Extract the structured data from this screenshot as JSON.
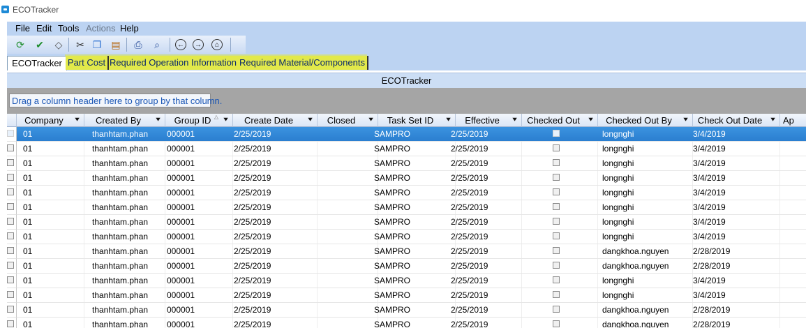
{
  "window": {
    "title": "ECOTracker"
  },
  "menu": [
    {
      "label": "File",
      "disabled": false
    },
    {
      "label": "Edit",
      "disabled": false
    },
    {
      "label": "Tools",
      "disabled": false
    },
    {
      "label": "Actions",
      "disabled": true
    },
    {
      "label": "Help",
      "disabled": false
    }
  ],
  "toolbar": [
    {
      "icon": "refresh-icon",
      "glyph": "⟳",
      "color": "#1c8c2a"
    },
    {
      "icon": "save-icon",
      "glyph": "✔",
      "color": "#1c8c2a"
    },
    {
      "icon": "eraser-icon",
      "glyph": "◇",
      "color": "#555555"
    },
    {
      "icon": "cut-icon",
      "glyph": "✂",
      "color": "#333333"
    },
    {
      "icon": "copy-icon",
      "glyph": "❐",
      "color": "#2a6fd1"
    },
    {
      "icon": "paste-icon",
      "glyph": "▤",
      "color": "#b76b17"
    },
    {
      "icon": "print-icon",
      "glyph": "⎙",
      "color": "#2a4f9a"
    },
    {
      "icon": "print-preview-icon",
      "glyph": "⌕",
      "color": "#2a4f9a"
    },
    {
      "icon": "back-icon",
      "glyph": "←",
      "color": "#222222"
    },
    {
      "icon": "forward-icon",
      "glyph": "→",
      "color": "#222222"
    },
    {
      "icon": "home-icon",
      "glyph": "⌂",
      "color": "#222222"
    }
  ],
  "tabs": [
    {
      "label": "ECOTracker",
      "active": true
    },
    {
      "label": "Part Cost",
      "active": false
    },
    {
      "label": "Required Operation Information",
      "active": false
    },
    {
      "label": "Required Material/Components",
      "active": false
    }
  ],
  "panel": {
    "title": "ECOTracker",
    "group_hint": "Drag a column header here to group by that column."
  },
  "columns": [
    "Company",
    "Created By",
    "Group ID",
    "Create Date",
    "Closed",
    "Task Set ID",
    "Effective",
    "Checked Out",
    "Checked Out By",
    "Check Out Date",
    "Ap"
  ],
  "rows": [
    {
      "company": "01",
      "created_by": "thanhtam.phan",
      "group_id": "000001",
      "create_date": "2/25/2019",
      "closed": false,
      "task_set_id": "SAMPRO",
      "effective": "2/25/2019",
      "checked_out": false,
      "checked_out_by": "longnghi",
      "check_out_date": "3/4/2019"
    },
    {
      "company": "01",
      "created_by": "thanhtam.phan",
      "group_id": "000001",
      "create_date": "2/25/2019",
      "closed": false,
      "task_set_id": "SAMPRO",
      "effective": "2/25/2019",
      "checked_out": false,
      "checked_out_by": "longnghi",
      "check_out_date": "3/4/2019"
    },
    {
      "company": "01",
      "created_by": "thanhtam.phan",
      "group_id": "000001",
      "create_date": "2/25/2019",
      "closed": false,
      "task_set_id": "SAMPRO",
      "effective": "2/25/2019",
      "checked_out": false,
      "checked_out_by": "longnghi",
      "check_out_date": "3/4/2019"
    },
    {
      "company": "01",
      "created_by": "thanhtam.phan",
      "group_id": "000001",
      "create_date": "2/25/2019",
      "closed": false,
      "task_set_id": "SAMPRO",
      "effective": "2/25/2019",
      "checked_out": false,
      "checked_out_by": "longnghi",
      "check_out_date": "3/4/2019"
    },
    {
      "company": "01",
      "created_by": "thanhtam.phan",
      "group_id": "000001",
      "create_date": "2/25/2019",
      "closed": false,
      "task_set_id": "SAMPRO",
      "effective": "2/25/2019",
      "checked_out": false,
      "checked_out_by": "longnghi",
      "check_out_date": "3/4/2019"
    },
    {
      "company": "01",
      "created_by": "thanhtam.phan",
      "group_id": "000001",
      "create_date": "2/25/2019",
      "closed": false,
      "task_set_id": "SAMPRO",
      "effective": "2/25/2019",
      "checked_out": false,
      "checked_out_by": "longnghi",
      "check_out_date": "3/4/2019"
    },
    {
      "company": "01",
      "created_by": "thanhtam.phan",
      "group_id": "000001",
      "create_date": "2/25/2019",
      "closed": false,
      "task_set_id": "SAMPRO",
      "effective": "2/25/2019",
      "checked_out": false,
      "checked_out_by": "longnghi",
      "check_out_date": "3/4/2019"
    },
    {
      "company": "01",
      "created_by": "thanhtam.phan",
      "group_id": "000001",
      "create_date": "2/25/2019",
      "closed": false,
      "task_set_id": "SAMPRO",
      "effective": "2/25/2019",
      "checked_out": false,
      "checked_out_by": "longnghi",
      "check_out_date": "3/4/2019"
    },
    {
      "company": "01",
      "created_by": "thanhtam.phan",
      "group_id": "000001",
      "create_date": "2/25/2019",
      "closed": false,
      "task_set_id": "SAMPRO",
      "effective": "2/25/2019",
      "checked_out": false,
      "checked_out_by": "dangkhoa.nguyen",
      "check_out_date": "2/28/2019"
    },
    {
      "company": "01",
      "created_by": "thanhtam.phan",
      "group_id": "000001",
      "create_date": "2/25/2019",
      "closed": false,
      "task_set_id": "SAMPRO",
      "effective": "2/25/2019",
      "checked_out": false,
      "checked_out_by": "dangkhoa.nguyen",
      "check_out_date": "2/28/2019"
    },
    {
      "company": "01",
      "created_by": "thanhtam.phan",
      "group_id": "000001",
      "create_date": "2/25/2019",
      "closed": false,
      "task_set_id": "SAMPRO",
      "effective": "2/25/2019",
      "checked_out": false,
      "checked_out_by": "longnghi",
      "check_out_date": "3/4/2019"
    },
    {
      "company": "01",
      "created_by": "thanhtam.phan",
      "group_id": "000001",
      "create_date": "2/25/2019",
      "closed": false,
      "task_set_id": "SAMPRO",
      "effective": "2/25/2019",
      "checked_out": false,
      "checked_out_by": "longnghi",
      "check_out_date": "3/4/2019"
    },
    {
      "company": "01",
      "created_by": "thanhtam.phan",
      "group_id": "000001",
      "create_date": "2/25/2019",
      "closed": false,
      "task_set_id": "SAMPRO",
      "effective": "2/25/2019",
      "checked_out": false,
      "checked_out_by": "dangkhoa.nguyen",
      "check_out_date": "2/28/2019"
    },
    {
      "company": "01",
      "created_by": "thanhtam.phan",
      "group_id": "000001",
      "create_date": "2/25/2019",
      "closed": false,
      "task_set_id": "SAMPRO",
      "effective": "2/25/2019",
      "checked_out": false,
      "checked_out_by": "dangkhoa.nguyen",
      "check_out_date": "2/28/2019"
    }
  ],
  "selected_row": 0
}
